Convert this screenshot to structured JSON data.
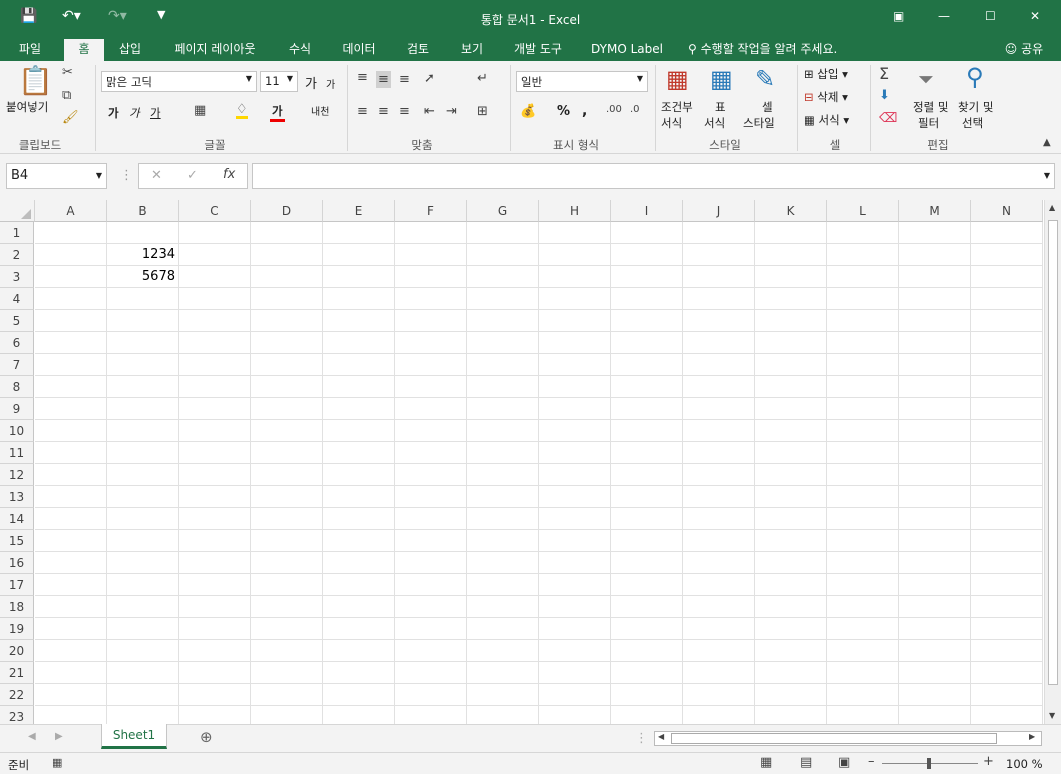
{
  "window": {
    "title": "통합 문서1 - Excel"
  },
  "tabs": [
    "파일",
    "홈",
    "삽입",
    "페이지 레이아웃",
    "수식",
    "데이터",
    "검토",
    "보기",
    "개발 도구",
    "DYMO Label"
  ],
  "tell_me": "수행할 작업을 알려 주세요.",
  "share": "공유",
  "ribbon": {
    "clipboard": {
      "paste": "붙여넣기",
      "label": "클립보드"
    },
    "font": {
      "name": "맑은 고딕",
      "size": "11",
      "grow": "가",
      "shrink": "가",
      "bold": "가",
      "italic": "가",
      "underline": "가",
      "color_a": "가",
      "phonetic": "내천",
      "label": "글꼴"
    },
    "alignment": {
      "label": "맞춤"
    },
    "number": {
      "format": "일반",
      "percent": "%",
      "comma": ",",
      "label": "표시 형식"
    },
    "styles": {
      "conditional": "조건부\n서식",
      "cond1": "조건부",
      "cond2": "서식",
      "table1": "표",
      "table2": "서식",
      "cell1": "셀",
      "cell2": "스타일",
      "label": "스타일"
    },
    "cells": {
      "insert": "삽입",
      "delete": "삭제",
      "format": "서식",
      "label": "셀"
    },
    "editing": {
      "sort1": "정렬 및",
      "sort2": "필터",
      "find1": "찾기 및",
      "find2": "선택",
      "label": "편집"
    }
  },
  "formula_bar": {
    "name_box": "B4",
    "fx": "fx",
    "value": ""
  },
  "columns": [
    "A",
    "B",
    "C",
    "D",
    "E",
    "F",
    "G",
    "H",
    "I",
    "J",
    "K",
    "L",
    "M",
    "N"
  ],
  "rows": [
    "1",
    "2",
    "3",
    "4",
    "5",
    "6",
    "7",
    "8",
    "9",
    "10",
    "11",
    "12",
    "13",
    "14",
    "15",
    "16",
    "17",
    "18",
    "19",
    "20",
    "21",
    "22",
    "23"
  ],
  "cells": {
    "B2": "1234",
    "B3": "5678"
  },
  "sheet_tabs": [
    "Sheet1"
  ],
  "status": {
    "ready": "준비",
    "zoom": "100 %"
  },
  "colors": {
    "accent": "#217346",
    "ribbon_bg": "#f3f3f3",
    "selected_tab_text": "#217346"
  }
}
